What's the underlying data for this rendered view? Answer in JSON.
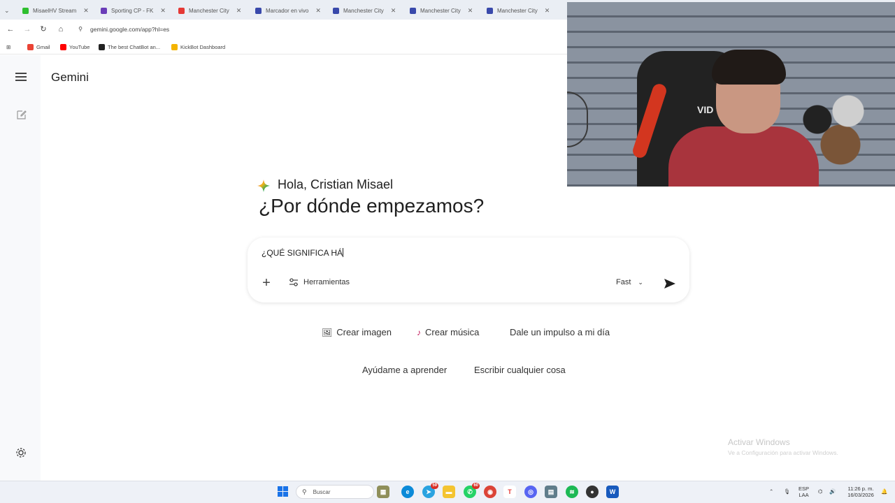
{
  "browser": {
    "tabs": [
      {
        "title": "MisaelHV Stream",
        "color": "#2fbf2f"
      },
      {
        "title": "Sporting CP - FK",
        "color": "#6a3db8"
      },
      {
        "title": "Manchester City",
        "color": "#e53935"
      },
      {
        "title": "Marcador en vivo",
        "color": "#3949ab"
      },
      {
        "title": "Manchester City",
        "color": "#3949ab"
      },
      {
        "title": "Manchester City",
        "color": "#3949ab"
      },
      {
        "title": "Manchester City",
        "color": "#3949ab"
      }
    ],
    "url": "gemini.google.com/app?hl=es",
    "bookmarks": [
      {
        "label": "Gmail",
        "color": "#ea4335"
      },
      {
        "label": "YouTube",
        "color": "#ff0000"
      },
      {
        "label": "The best ChatBot an...",
        "color": "#222222"
      },
      {
        "label": "KickBot Dashboard",
        "color": "#f4b400"
      }
    ]
  },
  "app": {
    "brand": "Gemini",
    "greeting": "Hola, Cristian Misael",
    "headline": "¿Por dónde empezamos?"
  },
  "prompt": {
    "text": "¿QUÉ SIGNIFICA HÁ",
    "tools_label": "Herramientas",
    "model_label": "Fast"
  },
  "chips": {
    "row1": [
      "Crear imagen",
      "Crear música",
      "Dale un impulso a mi día"
    ],
    "row2": [
      "Ayúdame a aprender",
      "Escribir cualquier cosa"
    ]
  },
  "webcam": {
    "chair_text": "VID"
  },
  "watermark": {
    "title": "Activar Windows",
    "subtitle": "Ve a Configuración para activar Windows."
  },
  "taskbar": {
    "search_placeholder": "Buscar",
    "badges": {
      "telegram": "59",
      "whatsapp": "60"
    },
    "lang_top": "ESP",
    "lang_bottom": "LAA",
    "time": "11:26 p. m.",
    "date": "16/03/2026"
  },
  "colors": {
    "accent": "#1a73e8",
    "rail_bg": "#f8f9fb",
    "tabbar_bg": "#eaeef4"
  }
}
